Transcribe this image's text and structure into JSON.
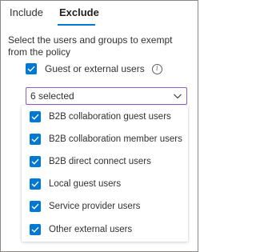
{
  "tabs": [
    {
      "label": "Include"
    },
    {
      "label": "Exclude"
    }
  ],
  "description": "Select the users and groups to exempt from the policy",
  "guest_checkbox": {
    "label": "Guest or external users",
    "checked": true,
    "info_icon": "info-icon"
  },
  "dropdown": {
    "value": "6 selected",
    "icon": "chevron-down-icon"
  },
  "options": [
    {
      "label": "B2B collaboration guest users",
      "checked": true
    },
    {
      "label": "B2B collaboration member users",
      "checked": true
    },
    {
      "label": "B2B direct connect users",
      "checked": true
    },
    {
      "label": "Local guest users",
      "checked": true
    },
    {
      "label": "Service provider users",
      "checked": true
    },
    {
      "label": "Other external users",
      "checked": true
    }
  ],
  "colors": {
    "accent": "#0078d4",
    "dropdown_border": "#8a5fc7",
    "text": "#323130"
  }
}
